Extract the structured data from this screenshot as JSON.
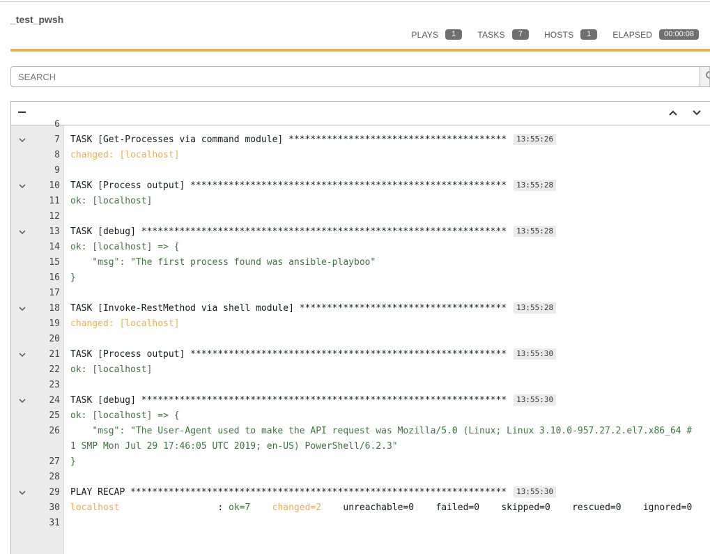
{
  "header": {
    "title": "_test_pwsh",
    "stats": [
      {
        "label": "PLAYS",
        "value": "1"
      },
      {
        "label": "TASKS",
        "value": "7"
      },
      {
        "label": "HOSTS",
        "value": "1"
      },
      {
        "label": "ELAPSED",
        "value": "00:00:08"
      }
    ],
    "accent_color": "#f0ad4e"
  },
  "search": {
    "placeholder": "SEARCH"
  },
  "output": {
    "collapse_label": "−",
    "lines": [
      {
        "n": "6",
        "parts": []
      },
      {
        "n": "7",
        "toggle": true,
        "parts": [
          {
            "t": "TASK [Get-Processes via command module] ****************************************",
            "c": "normal"
          }
        ],
        "ts": "13:55:26"
      },
      {
        "n": "8",
        "parts": [
          {
            "t": "changed: [localhost]",
            "c": "changed"
          }
        ]
      },
      {
        "n": "9",
        "parts": []
      },
      {
        "n": "10",
        "toggle": true,
        "parts": [
          {
            "t": "TASK [Process output] **********************************************************",
            "c": "normal"
          }
        ],
        "ts": "13:55:28"
      },
      {
        "n": "11",
        "parts": [
          {
            "t": "ok: [localhost]",
            "c": "ok"
          }
        ]
      },
      {
        "n": "12",
        "parts": []
      },
      {
        "n": "13",
        "toggle": true,
        "parts": [
          {
            "t": "TASK [debug] *******************************************************************",
            "c": "normal"
          }
        ],
        "ts": "13:55:28"
      },
      {
        "n": "14",
        "parts": [
          {
            "t": "ok: [localhost] => {",
            "c": "ok"
          }
        ]
      },
      {
        "n": "15",
        "parts": [
          {
            "t": "    \"msg\": \"The first process found was ansible-playboo\"",
            "c": "ok"
          }
        ]
      },
      {
        "n": "16",
        "parts": [
          {
            "t": "}",
            "c": "ok"
          }
        ]
      },
      {
        "n": "17",
        "parts": []
      },
      {
        "n": "18",
        "toggle": true,
        "parts": [
          {
            "t": "TASK [Invoke-RestMethod via shell module] **************************************",
            "c": "normal"
          }
        ],
        "ts": "13:55:28"
      },
      {
        "n": "19",
        "parts": [
          {
            "t": "changed: [localhost]",
            "c": "changed"
          }
        ]
      },
      {
        "n": "20",
        "parts": []
      },
      {
        "n": "21",
        "toggle": true,
        "parts": [
          {
            "t": "TASK [Process output] **********************************************************",
            "c": "normal"
          }
        ],
        "ts": "13:55:30"
      },
      {
        "n": "22",
        "parts": [
          {
            "t": "ok: [localhost]",
            "c": "ok"
          }
        ]
      },
      {
        "n": "23",
        "parts": []
      },
      {
        "n": "24",
        "toggle": true,
        "parts": [
          {
            "t": "TASK [debug] *******************************************************************",
            "c": "normal"
          }
        ],
        "ts": "13:55:30"
      },
      {
        "n": "25",
        "parts": [
          {
            "t": "ok: [localhost] => {",
            "c": "ok"
          }
        ]
      },
      {
        "n": "26",
        "wrap": true,
        "parts": [
          {
            "t": "    \"msg\": \"The User-Agent used to make the API request was Mozilla/5.0 (Linux; Linux 3.10.0-957.27.2.el7.x86_64 #1 SMP Mon Jul 29 17:46:05 UTC 2019; en-US) PowerShell/6.2.3\"",
            "c": "ok"
          }
        ]
      },
      {
        "n": "27",
        "parts": [
          {
            "t": "}",
            "c": "ok"
          }
        ]
      },
      {
        "n": "28",
        "parts": []
      },
      {
        "n": "29",
        "toggle": true,
        "parts": [
          {
            "t": "PLAY RECAP *********************************************************************",
            "c": "normal"
          }
        ],
        "ts": "13:55:30"
      },
      {
        "n": "30",
        "wrap": true,
        "parts": [
          {
            "t": "localhost",
            "c": "changed"
          },
          {
            "t": "                  : ",
            "c": "normal"
          },
          {
            "t": "ok=7",
            "c": "ok"
          },
          {
            "t": "    ",
            "c": "normal"
          },
          {
            "t": "changed=2",
            "c": "changed"
          },
          {
            "t": "    unreachable=0    failed=0    skipped=0    rescued=0    ignored=0",
            "c": "normal"
          }
        ]
      },
      {
        "n": "31",
        "parts": []
      }
    ]
  }
}
